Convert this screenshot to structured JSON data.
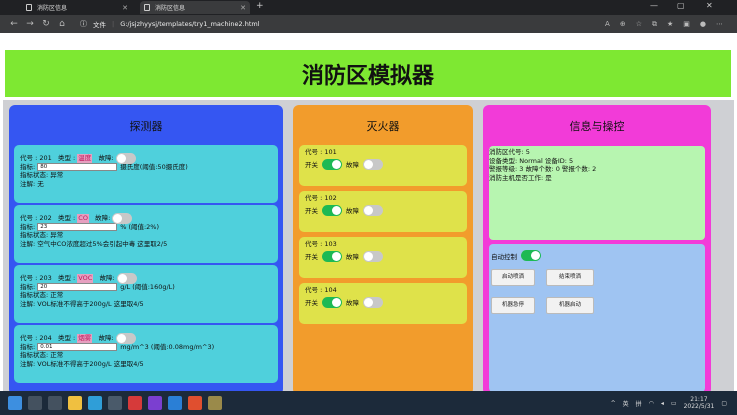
{
  "browser": {
    "tabs": [
      {
        "label": "消防区信息"
      },
      {
        "label": "消防区信息"
      }
    ],
    "new_tab": "+",
    "address": {
      "prefix": "文件",
      "url": "G:/jsjzhyysj/templates/try1_machine2.html"
    },
    "window_controls": [
      "—",
      "▢",
      "✕"
    ]
  },
  "page": {
    "title": "消防区模拟器",
    "detectors": {
      "heading": "探测器",
      "items": [
        {
          "id_label": "代号 : 201",
          "type_label": "类型 :",
          "type": "温度",
          "fault_label": "故障:",
          "fault_on": false,
          "value_label": "指标:",
          "value": "80",
          "unit": "摄氏度(阈值:50摄氏度)",
          "status": "指标状态: 异常",
          "note": "注解: 无"
        },
        {
          "id_label": "代号 : 202",
          "type_label": "类型 :",
          "type": "CO",
          "fault_label": "故障:",
          "fault_on": false,
          "value_label": "指标:",
          "value": "23",
          "unit": "% (阈值:2%)",
          "status": "指标状态: 异常",
          "note": "注解: 空气中CO浓度超过5%会引起中毒 这里取2/5"
        },
        {
          "id_label": "代号 : 203",
          "type_label": "类型 :",
          "type": "VOC",
          "fault_label": "故障:",
          "fault_on": false,
          "value_label": "指标:",
          "value": "20",
          "unit": "g/L (阈值:160g/L)",
          "status": "指标状态: 正常",
          "note": "注解: VOL标准不得高于200g/L 这里取4/5"
        },
        {
          "id_label": "代号 : 204",
          "type_label": "类型 :",
          "type": "烟雾",
          "fault_label": "故障:",
          "fault_on": false,
          "value_label": "指标:",
          "value": "0.01",
          "unit": "mg/m^3 (阈值:0.08mg/m^3)",
          "status": "指标状态: 正常",
          "note": "注解: VOL标准不得高于200g/L 这里取4/5"
        }
      ]
    },
    "extinguishers": {
      "heading": "灭火器",
      "items": [
        {
          "id_label": "代号 : 101",
          "switch_label": "开关",
          "switch_on": true,
          "fault_label": "故障",
          "fault_on": false
        },
        {
          "id_label": "代号 : 102",
          "switch_label": "开关",
          "switch_on": true,
          "fault_label": "故障",
          "fault_on": false
        },
        {
          "id_label": "代号 : 103",
          "switch_label": "开关",
          "switch_on": true,
          "fault_label": "故障",
          "fault_on": false
        },
        {
          "id_label": "代号 : 104",
          "switch_label": "开关",
          "switch_on": true,
          "fault_label": "故障",
          "fault_on": false
        }
      ]
    },
    "info": {
      "heading": "信息与操控",
      "lines": [
        "消防区代号: 5",
        "设备类型: Normal    设备ID: 5",
        "警报等级: 3    故障个数:  0    警报个数: 2",
        "消防主机是否工作: 是"
      ],
      "auto_control_label": "自动控制",
      "auto_control_on": true,
      "buttons": [
        "启动喷洒",
        "结束喷洒",
        "机器急停",
        "机器启动"
      ]
    }
  },
  "taskbar": {
    "tray": {
      "lang1": "英",
      "lang2": "拼",
      "time": "21:17",
      "date": "2022/5/31"
    }
  },
  "colors": {
    "banner": "#7ee832",
    "detectors_bg": "#3556f2",
    "extinguishers_bg": "#f29c2c",
    "info_bg": "#f23bd8",
    "detector_card": "#4fd0dc",
    "extinguisher_card": "#dfe24a",
    "info_box": "#b7f5b0",
    "control_box": "#9fc4f2",
    "toggle_on": "#1db954"
  }
}
